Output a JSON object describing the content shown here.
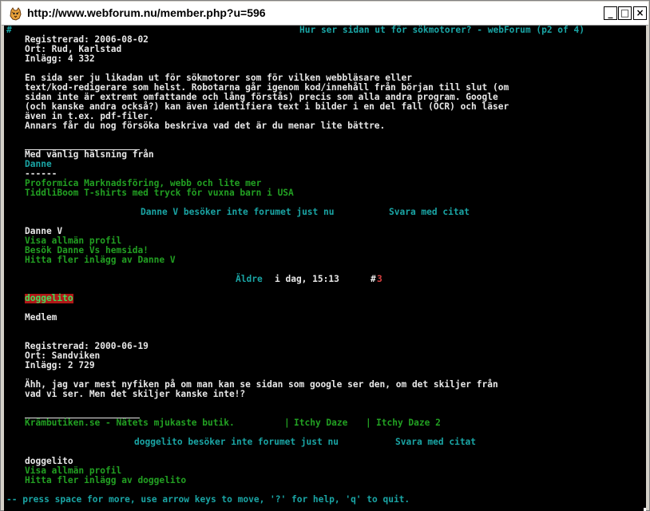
{
  "window": {
    "title": "http://www.webforum.nu/member.php?u=596",
    "minimize_label": "_",
    "maximize_label": "□",
    "close_label": "×"
  },
  "terminal": {
    "top_left_marker": "#",
    "page_title": "Hur ser sidan ut för sökmotorer? - webForum (p2 of 4)",
    "post1": {
      "registered": "Registrerad: 2006-08-02",
      "location": "Ort: Rud, Karlstad",
      "posts": "Inlägg: 4 332",
      "body": [
        "En sida ser ju likadan ut för sökmotorer som för vilken webbläsare eller",
        "text/kod-redigerare som helst. Robotarna går igenom kod/innehåll från början till slut (om",
        "sidan inte är extremt omfattande och lång förstås) precis som alla andra program. Google",
        "(och kanske andra också?) kan även identifiera text i bilder i en del fall (OCR) och läser",
        "även in t.ex. pdf-filer.",
        "Annars får du nog försöka beskriva vad det är du menar lite bättre."
      ],
      "signature_greeting": "Med vänlig hälsning från",
      "signature_name": "Danne",
      "signature_dashes": "------",
      "signature_link1": "Proformica Marknadsföring, webb och lite mer",
      "signature_link2": "TiddliBoom T-shirts med tryck för vuxna barn i USA",
      "offline_status": "Danne V besöker inte forumet just nu",
      "reply_quote": "Svara med citat",
      "username": "Danne V",
      "profile_link": "Visa allmän profil",
      "homepage_link": "Besök Danne Vs hemsida!",
      "more_posts_link": "Hitta fler inlägg av Danne V"
    },
    "post_header": {
      "older_link": "Äldre",
      "timestamp": "i dag, 15:13",
      "hash": "#",
      "post_number": "3"
    },
    "post2": {
      "username_highlight": "doggelito",
      "rank": "Medlem",
      "registered": "Registrerad: 2000-06-19",
      "location": "Ort: Sandviken",
      "posts": "Inlägg: 2 729",
      "body": [
        "Ähh, jag var mest nyfiken på om man kan se sidan som google ser den, om det skiljer från",
        "vad vi ser. Men det skiljer kanske inte!?"
      ],
      "signature_link1": "Krämbutiken.se - Nätets mjukaste butik.",
      "signature_sep1": "|",
      "signature_link2": "Itchy Daze",
      "signature_sep2": "|",
      "signature_link3": "Itchy Daze 2",
      "offline_status": "doggelito besöker inte forumet just nu",
      "reply_quote": "Svara med citat",
      "username": "doggelito",
      "profile_link": "Visa allmän profil",
      "more_posts_link": "Hitta fler inlägg av doggelito"
    },
    "status_bar": "-- press space for more, use arrow keys to move, '?' for help, 'q' to quit."
  },
  "colors": {
    "terminal_bg": "#000000",
    "text_white": "#e8e8e8",
    "link_cyan": "#1aa5a5",
    "link_green": "#22a022",
    "highlight_bg": "#b01818",
    "highlight_fg": "#3fe05a"
  },
  "icons": {
    "app_icon": "lynx-cat-icon"
  }
}
